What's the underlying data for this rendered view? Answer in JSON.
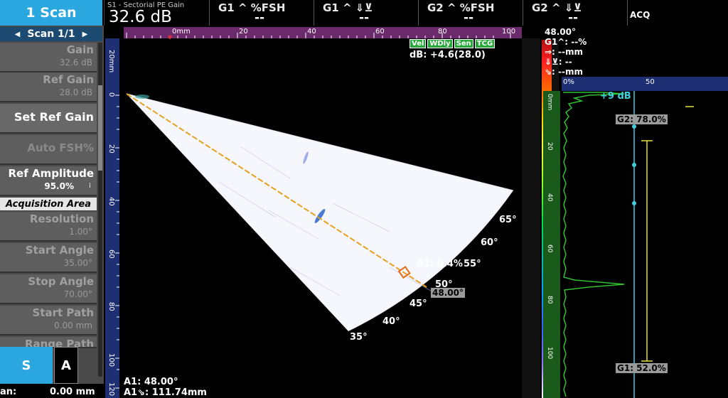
{
  "top": {
    "scan_tab": "1 Scan",
    "gain_title": "S1 - Sectorial PE Gain",
    "gain_value": "32.6 dB",
    "readings": [
      {
        "label": "G1 ^ %FSH",
        "value": "--"
      },
      {
        "label": "G1 ^ ⇓⊻",
        "value": "--"
      },
      {
        "label": "G2 ^ %FSH",
        "value": "--"
      },
      {
        "label": "G2 ^ ⇓⊻",
        "value": "--"
      }
    ],
    "acq": "ACQ"
  },
  "left": {
    "header": "Scan 1/1",
    "gain_label": "Gain",
    "gain_value": "32.6 dB",
    "ref_gain_label": "Ref Gain",
    "ref_gain_value": "28.0 dB",
    "set_ref_gain": "Set Ref Gain",
    "auto_fsh": "Auto FSH%",
    "ref_amp_label": "Ref Amplitude",
    "ref_amp_value": "95.0%",
    "section": "Acquisition Area",
    "resolution_label": "Resolution",
    "resolution_value": "1.00°",
    "start_angle_label": "Start Angle",
    "start_angle_value": "35.00°",
    "stop_angle_label": "Stop Angle",
    "stop_angle_value": "70.00°",
    "start_path_label": "Start Path",
    "start_path_value": "0.00 mm",
    "range_path_label": "Range Path",
    "s_button": "S",
    "a_button": "A",
    "bottom_left": "an:",
    "bottom_value": "0.00 mm"
  },
  "view": {
    "top_ruler_unit": "0mm",
    "top_ticks": [
      "20",
      "40",
      "60",
      "80",
      "100"
    ],
    "left_ruler_unit": "20mm",
    "left_ticks": [
      "0",
      "20",
      "40",
      "60",
      "80",
      "100",
      "120"
    ],
    "badges": [
      "Vel",
      "WDly",
      "Sen",
      "TCG"
    ],
    "db_readout": "dB: +4.6(28.0)",
    "angles": [
      "35°",
      "40°",
      "45°",
      "50°",
      "55°",
      "60°",
      "65°"
    ],
    "cursor_amp": "A1: 0.4%",
    "cursor_angle": "48.00°",
    "bottom_a1": "A1: 48.00°",
    "bottom_path": "A1⇘: 111.74mm"
  },
  "right": {
    "angle": "48.00°",
    "g1_line": "G1^: --%",
    "arrow_line": "⇒: --mm",
    "depth_line": "⇓⊻: --",
    "diag_line": "⇘: --mm",
    "top_ticks": [
      "0%",
      "50"
    ],
    "gain_note": "+9 dB",
    "g2_label": "G2: 78.0%",
    "g1_label": "G1: 52.0%",
    "left_ticks": [
      "0mm",
      "20",
      "40",
      "60",
      "80",
      "100"
    ]
  },
  "colors": {
    "accent": "#2aa7df",
    "gate_a": "#3fd0e0",
    "gate_b": "#e8e040",
    "cursor": "#e08a20",
    "ascan": "#30c030"
  }
}
